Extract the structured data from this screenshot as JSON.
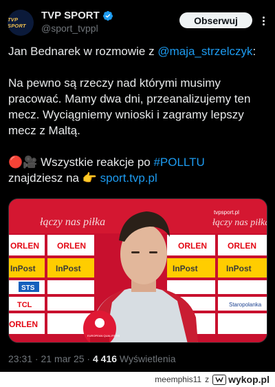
{
  "author": {
    "avatar_text": "TVP SPORT",
    "name": "TVP SPORT",
    "handle": "@sport_tvppl",
    "verified_icon": "verified-badge-icon"
  },
  "actions": {
    "follow_label": "Obserwuj",
    "more_icon": "more-options-icon"
  },
  "tweet": {
    "line1_prefix": "Jan Bednarek w rozmowie z ",
    "line1_mention": "@maja_strzelczyk",
    "line1_suffix": ":",
    "paragraph2": "Na pewno są rzeczy nad którymi musimy pracować. Mamy dwa dni, przeanalizujemy ten mecz. Wyciągniemy wnioski i zagramy lepszy mecz z Maltą.",
    "p3_emoji": "🔴🎥",
    "p3_prefix": " Wszystkie reakcje po ",
    "p3_hashtag": "#POLLTU",
    "p4_prefix": "znajdziesz na ",
    "p4_emoji": "👉",
    "p4_link": "sport.tvp.pl"
  },
  "media": {
    "banner_text": "łączy nas piłka",
    "banner_text_right": "łączy nas piłka",
    "site_text": "tvpsport.pl",
    "sponsors": [
      "ORLEN",
      "InPost",
      "STS",
      "TCL",
      "Staropolanka"
    ],
    "mic_text": "EUROPEAN QUALIFIERS"
  },
  "meta": {
    "time": "23:31",
    "separator": " · ",
    "date": "21 mar 25",
    "separator2": " · ",
    "views_count": "4 416",
    "views_label": " Wyświetlenia"
  },
  "watermark": {
    "user": "meemphis11",
    "z": "z",
    "site": "wykop.pl"
  }
}
